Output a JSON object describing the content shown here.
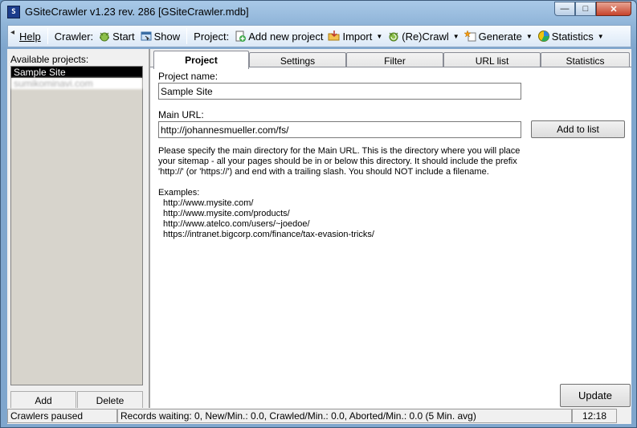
{
  "window": {
    "title": "GSiteCrawler v1.23 rev. 286 [GSiteCrawler.mdb]",
    "app_icon_text": "S",
    "controls": {
      "minimize": "—",
      "maximize": "□",
      "close": "✕"
    }
  },
  "toolbar": {
    "help": "Help",
    "crawler_label": "Crawler:",
    "start": "Start",
    "show": "Show",
    "project_label": "Project:",
    "add_new_project": "Add new project",
    "import": "Import",
    "recrawl": "(Re)Crawl",
    "generate": "Generate",
    "statistics": "Statistics"
  },
  "left_panel": {
    "label": "Available projects:",
    "projects": [
      {
        "name": "Sample Site"
      },
      {
        "name": "sumikominavi.com"
      }
    ],
    "add_button": "Add",
    "delete_button": "Delete"
  },
  "tabs": [
    "Project",
    "Settings",
    "Filter",
    "URL list",
    "Statistics"
  ],
  "project_tab": {
    "project_name_label": "Project name:",
    "project_name_value": "Sample Site",
    "main_url_label": "Main URL:",
    "main_url_value": "http://johannesmueller.com/fs/",
    "add_to_list_button": "Add to list",
    "help_paragraph": "Please specify the main directory for the Main URL. This is the directory where you will place your sitemap - all your pages should be in or below this directory. It should include the prefix 'http://' (or 'https://') and end with a trailing slash.  You should NOT include a filename.",
    "examples_label": "Examples:",
    "examples": [
      "http://www.mysite.com/",
      "http://www.mysite.com/products/",
      "http://www.atelco.com/users/~joedoe/",
      "https://intranet.bigcorp.com/finance/tax-evasion-tricks/"
    ],
    "update_button": "Update"
  },
  "statusbar": {
    "crawler_status": "Crawlers paused",
    "records": "Records waiting: 0, New/Min.: 0.0, Crawled/Min.: 0.0, Aborted/Min.: 0.0 (5 Min. avg)",
    "time": "12:18"
  }
}
